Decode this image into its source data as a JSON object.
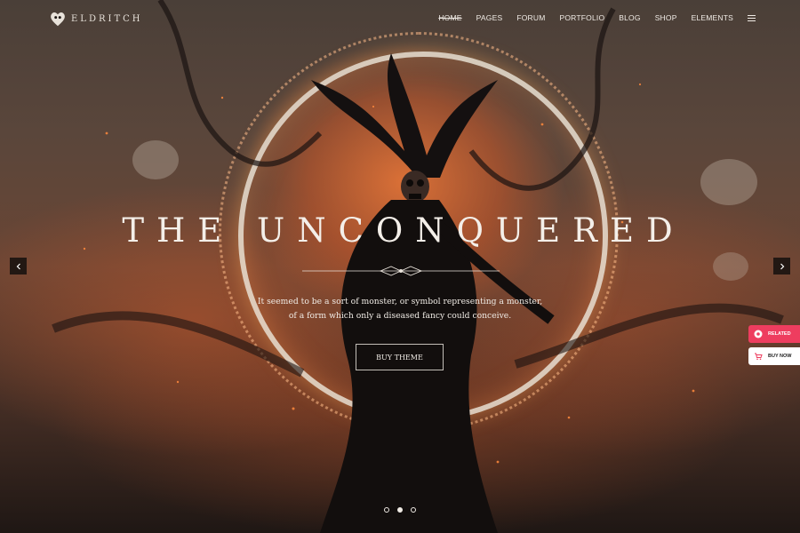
{
  "brand": {
    "name": "ELDRITCH"
  },
  "nav": {
    "items": [
      "HOME",
      "PAGES",
      "FORUM",
      "PORTFOLIO",
      "BLOG",
      "SHOP",
      "ELEMENTS"
    ],
    "active": "HOME"
  },
  "hero": {
    "title": "THE UNCONQUERED",
    "line1": "It seemed to be a sort of monster, or symbol representing a monster,",
    "line2": "of a form which only a diseased fancy could conceive.",
    "button": "BUY THEME"
  },
  "slider": {
    "slide_count": 3,
    "active_index": 1
  },
  "side_widgets": {
    "related": "RELATED",
    "buy_now": "BUY NOW"
  },
  "colors": {
    "accent": "#ee3d5f",
    "text": "#f1ece6",
    "glow": "#e8784a"
  }
}
